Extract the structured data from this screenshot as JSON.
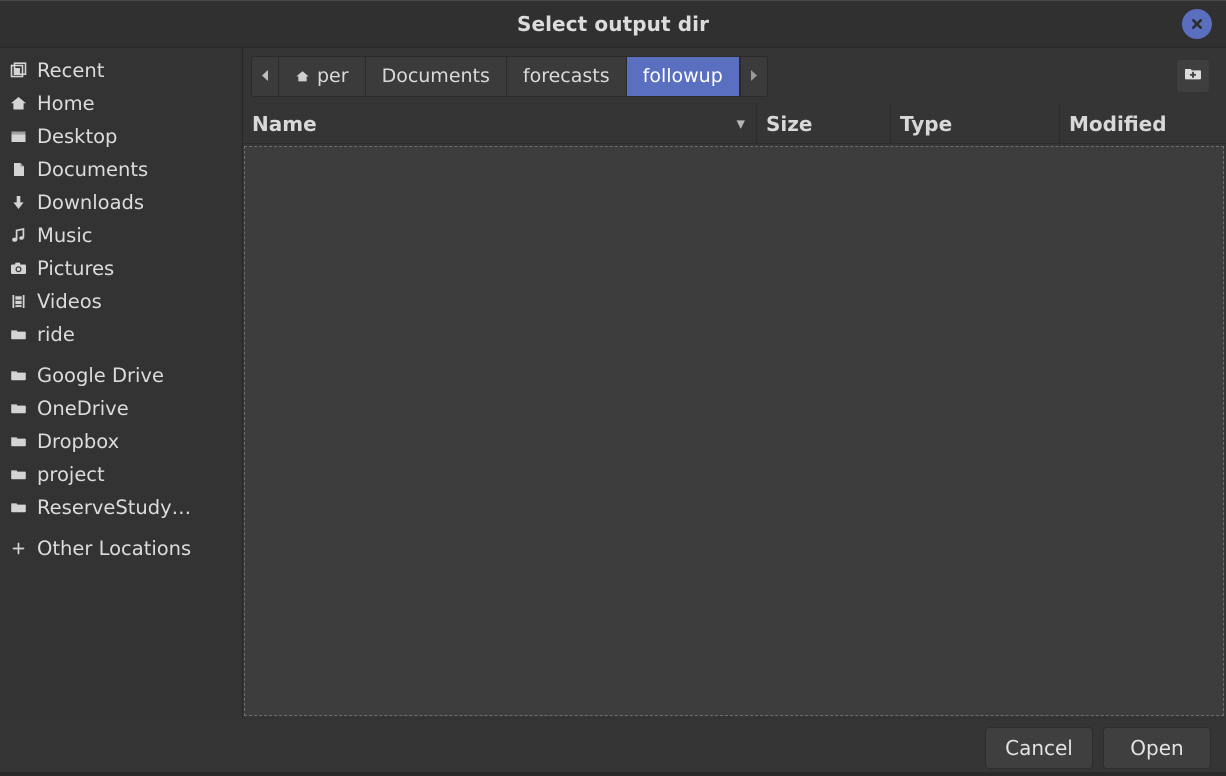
{
  "window": {
    "title": "Select output dir",
    "close_icon": "close-icon"
  },
  "sidebar": {
    "items": [
      {
        "label": "Recent",
        "icon": "recent-icon"
      },
      {
        "label": "Home",
        "icon": "home-icon"
      },
      {
        "label": "Desktop",
        "icon": "desktop-icon"
      },
      {
        "label": "Documents",
        "icon": "document-icon"
      },
      {
        "label": "Downloads",
        "icon": "download-icon"
      },
      {
        "label": "Music",
        "icon": "music-icon"
      },
      {
        "label": "Pictures",
        "icon": "pictures-icon"
      },
      {
        "label": "Videos",
        "icon": "video-icon"
      },
      {
        "label": "ride",
        "icon": "folder-icon"
      }
    ],
    "bookmarks": [
      {
        "label": "Google Drive",
        "icon": "folder-icon"
      },
      {
        "label": "OneDrive",
        "icon": "folder-icon"
      },
      {
        "label": "Dropbox",
        "icon": "folder-icon"
      },
      {
        "label": "project",
        "icon": "folder-icon"
      },
      {
        "label": "ReserveStudy…",
        "icon": "folder-icon"
      }
    ],
    "other_locations": {
      "label": "Other Locations",
      "icon": "plus-icon"
    }
  },
  "pathbar": {
    "prev_arrow_icon": "chevron-left-icon",
    "next_arrow_icon": "chevron-right-icon",
    "crumbs": [
      {
        "label": "per",
        "icon": "home-icon",
        "selected": false
      },
      {
        "label": "Documents",
        "icon": "",
        "selected": false
      },
      {
        "label": "forecasts",
        "icon": "",
        "selected": false
      },
      {
        "label": "followup",
        "icon": "",
        "selected": true
      }
    ],
    "new_folder_icon": "new-folder-icon"
  },
  "columns": {
    "name": "Name",
    "size": "Size",
    "type": "Type",
    "modified": "Modified",
    "sort_indicator": "▼"
  },
  "filelist": {
    "rows": []
  },
  "footer": {
    "cancel_label": "Cancel",
    "open_label": "Open"
  },
  "colors": {
    "accent": "#5a6fc0",
    "window_bg": "#353535",
    "sidebar_bg": "#333333",
    "list_bg": "#3d3d3d",
    "text": "#dcdcdc"
  }
}
